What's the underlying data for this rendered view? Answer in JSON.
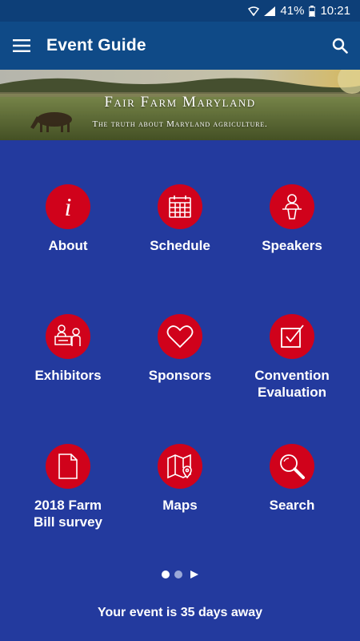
{
  "status_bar": {
    "battery": "41%",
    "time": "10:21"
  },
  "app_bar": {
    "title": "Event Guide"
  },
  "banner": {
    "title": "Fair Farm Maryland",
    "subtitle": "The truth about Maryland agriculture."
  },
  "tiles": [
    {
      "label": "About",
      "icon": "info-icon"
    },
    {
      "label": "Schedule",
      "icon": "calendar-icon"
    },
    {
      "label": "Speakers",
      "icon": "speaker-podium-icon"
    },
    {
      "label": "Exhibitors",
      "icon": "exhibitor-booth-icon"
    },
    {
      "label": "Sponsors",
      "icon": "heart-icon"
    },
    {
      "label": "Convention\nEvaluation",
      "icon": "checkbox-icon"
    },
    {
      "label": "2018 Farm\nBill survey",
      "icon": "document-icon"
    },
    {
      "label": "Maps",
      "icon": "map-icon"
    },
    {
      "label": "Search",
      "icon": "magnifier-icon"
    }
  ],
  "footer": {
    "text": "Your event is 35 days away"
  },
  "colors": {
    "background": "#233a9e",
    "app_bar": "#0f4a87",
    "tile_circle": "#d0021b"
  }
}
